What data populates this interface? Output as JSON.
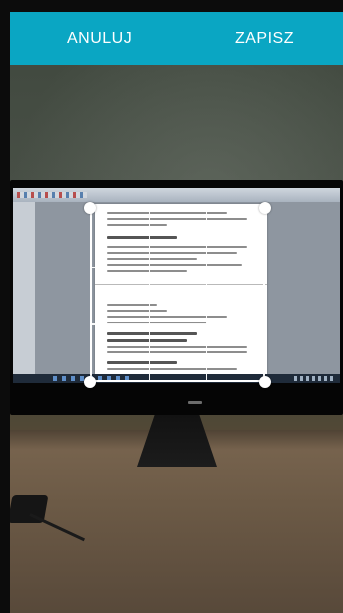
{
  "toolbar": {
    "cancel_label": "ANULUJ",
    "save_label": "ZAPISZ"
  },
  "colors": {
    "toolbar_bg": "#0aa6c3",
    "toolbar_text": "#ffffff",
    "crop_handle": "#ffffff"
  },
  "crop": {
    "grid_rows": 3,
    "grid_cols": 3
  }
}
